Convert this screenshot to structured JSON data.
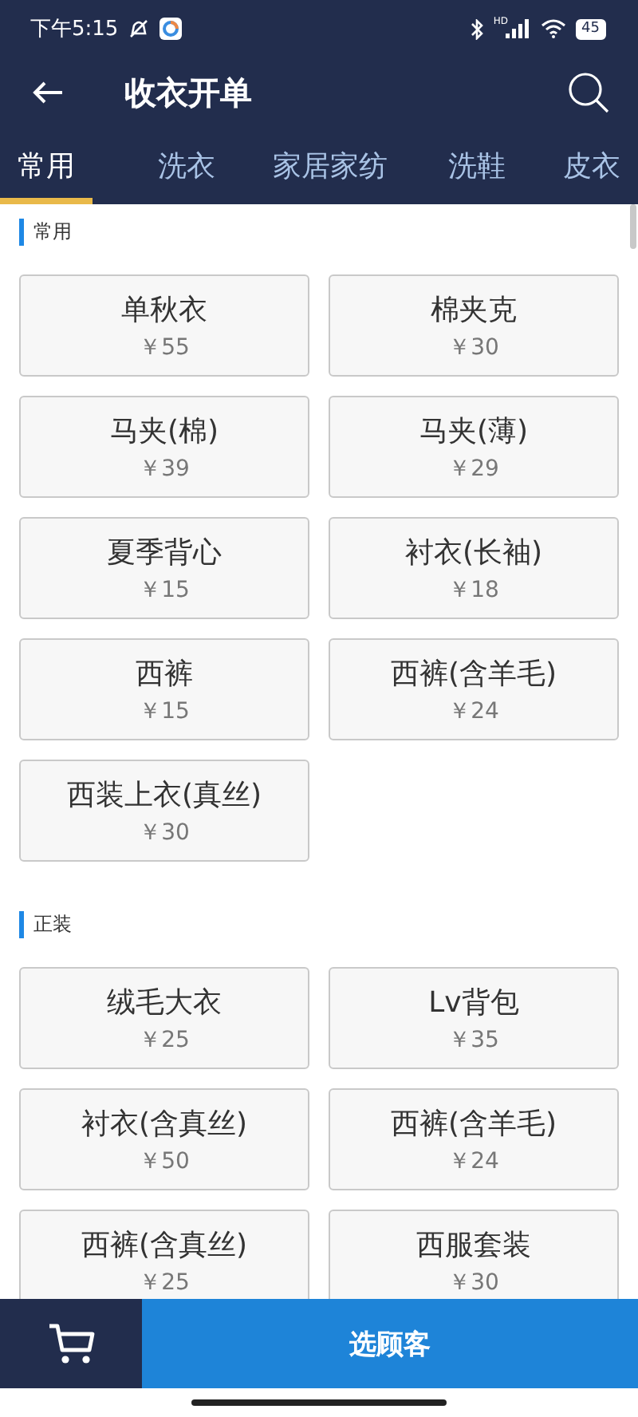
{
  "status_bar": {
    "time": "下午5:15",
    "network": "HD",
    "battery": "45"
  },
  "header": {
    "title": "收衣开单"
  },
  "tabs": [
    {
      "label": "常用",
      "selected": true
    },
    {
      "label": "洗衣",
      "selected": false
    },
    {
      "label": "家居家纺",
      "selected": false
    },
    {
      "label": "洗鞋",
      "selected": false
    },
    {
      "label": "皮衣",
      "selected": false
    }
  ],
  "sections": [
    {
      "title": "常用",
      "items": [
        {
          "name": "单秋衣",
          "price": "￥55"
        },
        {
          "name": "棉夹克",
          "price": "￥30"
        },
        {
          "name": "马夹(棉)",
          "price": "￥39"
        },
        {
          "name": "马夹(薄)",
          "price": "￥29"
        },
        {
          "name": "夏季背心",
          "price": "￥15"
        },
        {
          "name": "衬衣(长袖)",
          "price": "￥18"
        },
        {
          "name": "西裤",
          "price": "￥15"
        },
        {
          "name": "西裤(含羊毛)",
          "price": "￥24"
        },
        {
          "name": "西装上衣(真丝)",
          "price": "￥30"
        }
      ]
    },
    {
      "title": "正装",
      "items": [
        {
          "name": "绒毛大衣",
          "price": "￥25"
        },
        {
          "name": "Lv背包",
          "price": "￥35"
        },
        {
          "name": "衬衣(含真丝)",
          "price": "￥50"
        },
        {
          "name": "西裤(含羊毛)",
          "price": "￥24"
        },
        {
          "name": "西裤(含真丝)",
          "price": "￥25"
        },
        {
          "name": "西服套装",
          "price": "￥30"
        }
      ]
    }
  ],
  "bottom_bar": {
    "button": "选顾客"
  }
}
